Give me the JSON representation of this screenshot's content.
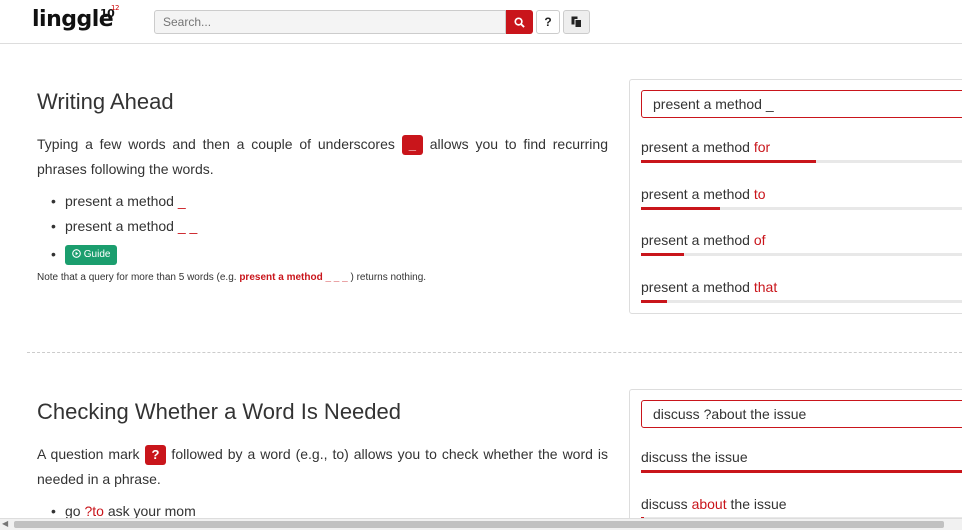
{
  "header": {
    "logo": "linggle",
    "logo_sup": "10",
    "logo_sup2": "12",
    "search_placeholder": "Search...",
    "help_label": "?",
    "search_icon": "search-icon",
    "copy_icon": "copy-icon"
  },
  "section1": {
    "title": "Writing Ahead",
    "para_before": "Typing a few words and then a couple of underscores ",
    "para_badge": "_",
    "para_after": " allows you to find recurring phrases following the words.",
    "items": [
      {
        "text": "present a method ",
        "red": "_"
      },
      {
        "text": "present a method ",
        "red": "_ _"
      }
    ],
    "guide_icon": "play-circle-icon",
    "guide_label": "Guide",
    "note_before": "Note that a query for more than 5 words (e.g. ",
    "note_bold": "present a method _ _ _",
    "note_after": " ) returns nothing."
  },
  "panel1": {
    "query": "present a method _",
    "results": [
      {
        "prefix": "present a method ",
        "word": "for",
        "share": 0.53
      },
      {
        "prefix": "present a method ",
        "word": "to",
        "share": 0.24
      },
      {
        "prefix": "present a method ",
        "word": "of",
        "share": 0.13
      },
      {
        "prefix": "present a method ",
        "word": "that",
        "share": 0.08
      }
    ]
  },
  "section2": {
    "title": "Checking Whether a Word Is Needed",
    "para_before": "A question mark ",
    "para_badge": "?",
    "para_after": " followed by a word (e.g., to) allows you to check whether the word is needed in a phrase.",
    "items": [
      {
        "text": "go ",
        "red": "?to",
        "after": " ask your mom"
      }
    ]
  },
  "panel2": {
    "query": "discuss ?about the issue",
    "results": [
      {
        "prefix": "discuss the issue",
        "word": "",
        "suffix": "",
        "share": 1.0
      },
      {
        "prefix": "discuss ",
        "word": "about",
        "suffix": " the issue",
        "share": 0.01
      }
    ]
  },
  "colors": {
    "accent": "#c9151b",
    "guide": "#1b9e6e"
  }
}
